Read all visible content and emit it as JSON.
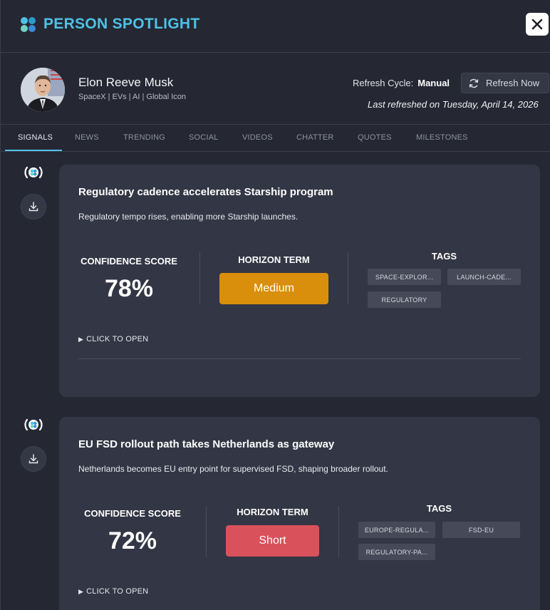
{
  "header": {
    "title": "PERSON SPOTLIGHT",
    "logo_colors": [
      "#4fc1e6",
      "#2b9bc9",
      "#6fd2c4",
      "#3a8bd8"
    ]
  },
  "profile": {
    "name": "Elon Reeve Musk",
    "subtitle": "SpaceX | EVs | AI | Global Icon",
    "refresh_cycle_label": "Refresh Cycle:",
    "refresh_cycle_value": "Manual",
    "refresh_button_label": "Refresh Now",
    "last_refreshed": "Last refreshed on Tuesday, April 14, 2026"
  },
  "tabs": [
    {
      "label": "SIGNALS",
      "active": true
    },
    {
      "label": "NEWS"
    },
    {
      "label": "TRENDING"
    },
    {
      "label": "SOCIAL"
    },
    {
      "label": "VIDEOS"
    },
    {
      "label": "CHATTER"
    },
    {
      "label": "QUOTES"
    },
    {
      "label": "MILESTONES"
    }
  ],
  "signals": [
    {
      "title": "Regulatory cadence accelerates Starship program",
      "summary": "Regulatory tempo rises, enabling more Starship launches.",
      "confidence_label": "CONFIDENCE SCORE",
      "confidence_value": "78%",
      "horizon_label": "HORIZON TERM",
      "horizon_value": "Medium",
      "horizon_color": "#d98e0c",
      "tags_label": "TAGS",
      "tags": [
        "SPACE-EXPLOR...",
        "LAUNCH-CADE...",
        "REGULATORY"
      ],
      "open_label": "CLICK TO OPEN"
    },
    {
      "title": "EU FSD rollout path takes Netherlands as gateway",
      "summary": "Netherlands becomes EU entry point for supervised FSD, shaping broader rollout.",
      "confidence_label": "CONFIDENCE SCORE",
      "confidence_value": "72%",
      "horizon_label": "HORIZON TERM",
      "horizon_value": "Short",
      "horizon_color": "#d9515a",
      "tags_label": "TAGS",
      "tags": [
        "EUROPE-REGULA...",
        "FSD-EU",
        "REGULATORY-PA..."
      ],
      "open_label": "CLICK TO OPEN"
    }
  ],
  "icons": {
    "close": "close-icon",
    "refresh": "refresh-icon",
    "download": "download-icon",
    "signal": "signal-logo-icon"
  }
}
